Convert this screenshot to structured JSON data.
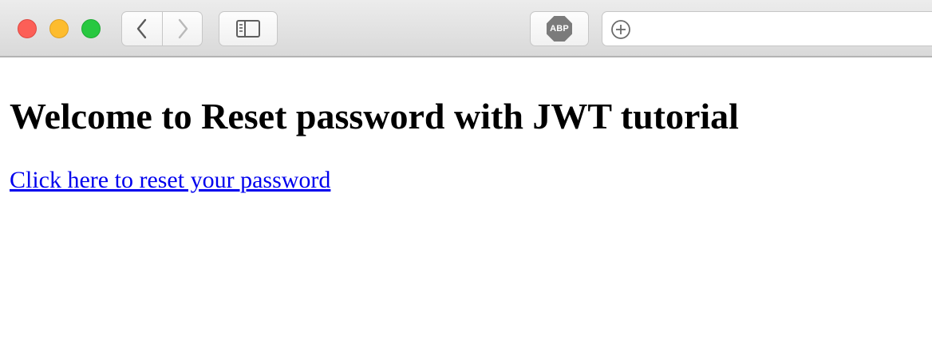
{
  "window": {
    "controls": [
      "close",
      "minimize",
      "zoom"
    ]
  },
  "toolbar": {
    "back_icon": "chevron-left-icon",
    "forward_icon": "chevron-right-icon",
    "sidebar_icon": "sidebar-icon",
    "adblock_label": "ABP",
    "new_tab_icon": "plus-circle-icon"
  },
  "page": {
    "heading": "Welcome to Reset password with JWT tutorial",
    "link_text": "Click here to reset your password"
  },
  "colors": {
    "close": "#fc5f57",
    "minimize": "#fdbc2e",
    "zoom": "#28c840",
    "link": "#0000ee",
    "abp_badge": "#7b7b7b"
  }
}
